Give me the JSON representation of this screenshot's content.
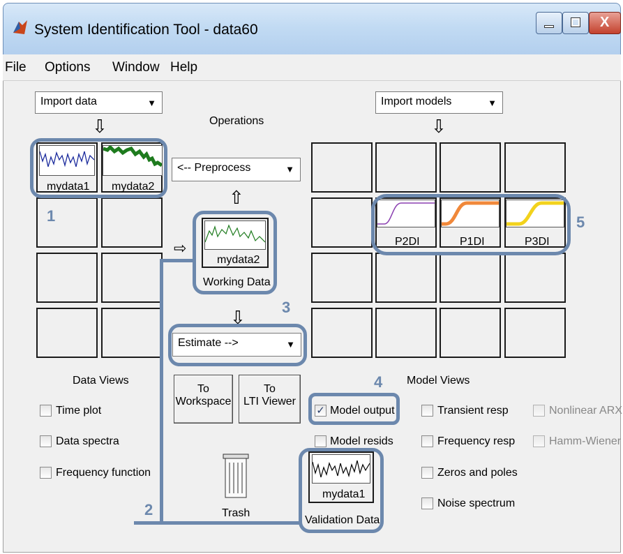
{
  "window": {
    "title": "System Identification Tool - data60"
  },
  "menu": [
    "File",
    "Options",
    "Window",
    "Help"
  ],
  "import_data": {
    "value": "Import data"
  },
  "import_models": {
    "value": "Import models"
  },
  "operations": {
    "heading": "Operations",
    "preprocess": "<-- Preprocess",
    "estimate": "Estimate -->"
  },
  "data_board": {
    "items": [
      "mydata1",
      "mydata2"
    ]
  },
  "working_data": {
    "name": "mydata2",
    "caption": "Working Data"
  },
  "validation_data": {
    "name": "mydata1",
    "caption": "Validation Data"
  },
  "model_board": {
    "items": [
      "P2DI",
      "P1DI",
      "P3DI"
    ]
  },
  "buttons": {
    "to_workspace_1": "To",
    "to_workspace_2": "Workspace",
    "to_lti_1": "To",
    "to_lti_2": "LTI Viewer",
    "trash": "Trash"
  },
  "data_views": {
    "heading": "Data Views",
    "items": [
      "Time plot",
      "Data spectra",
      "Frequency function"
    ]
  },
  "model_views": {
    "heading": "Model Views",
    "col1": [
      {
        "label": "Model output",
        "checked": true
      },
      {
        "label": "Model resids",
        "checked": false
      }
    ],
    "col2": [
      "Transient resp",
      "Frequency resp",
      "Zeros and poles",
      "Noise spectrum"
    ],
    "col3": [
      "Nonlinear ARX",
      "Hamm-Wiener"
    ]
  },
  "annotations": [
    "1",
    "2",
    "3",
    "4",
    "5"
  ],
  "colors": {
    "highlight": "#6c88ad",
    "mydata2_line": "#1e7b1e",
    "mydata1_line": "#1a2a9c",
    "p2di": "#8a3fb0",
    "p1di": "#f0883a",
    "p3di": "#f2d21c"
  }
}
